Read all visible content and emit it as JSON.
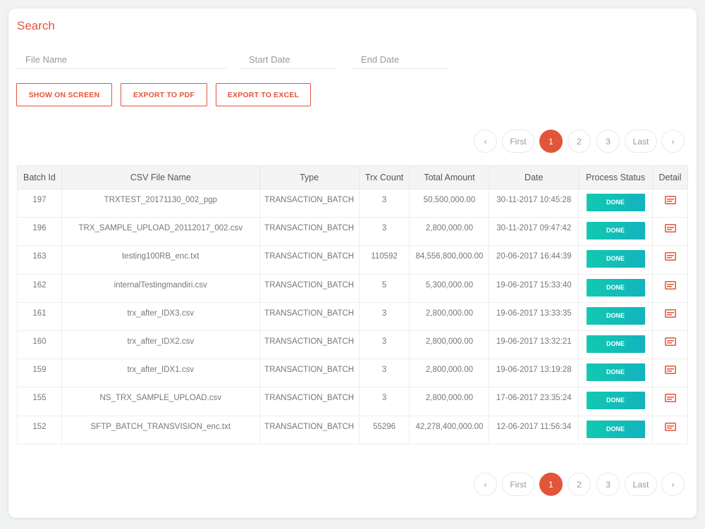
{
  "search": {
    "title": "Search",
    "file_name_placeholder": "File Name",
    "start_date_placeholder": "Start Date",
    "end_date_placeholder": "End Date"
  },
  "buttons": {
    "show_on_screen": "SHOW ON SCREEN",
    "export_pdf": "EXPORT TO PDF",
    "export_excel": "EXPORT TO EXCEL"
  },
  "pagination": {
    "prev": "‹",
    "first": "First",
    "pages": [
      "1",
      "2",
      "3"
    ],
    "current": "1",
    "last": "Last",
    "next": "›"
  },
  "table": {
    "headers": [
      "Batch Id",
      "CSV File Name",
      "Type",
      "Trx Count",
      "Total Amount",
      "Date",
      "Process Status",
      "Detail"
    ],
    "rows": [
      {
        "id": "197",
        "file": "TRXTEST_20171130_002_pgp",
        "type": "TRANSACTION_BATCH",
        "count": "3",
        "amount": "50,500,000.00",
        "date": "30-11-2017 10:45:28",
        "status": "DONE"
      },
      {
        "id": "196",
        "file": "TRX_SAMPLE_UPLOAD_20112017_002.csv",
        "type": "TRANSACTION_BATCH",
        "count": "3",
        "amount": "2,800,000.00",
        "date": "30-11-2017 09:47:42",
        "status": "DONE"
      },
      {
        "id": "163",
        "file": "testing100RB_enc.txt",
        "type": "TRANSACTION_BATCH",
        "count": "110592",
        "amount": "84,556,800,000.00",
        "date": "20-06-2017 16:44:39",
        "status": "DONE"
      },
      {
        "id": "162",
        "file": "internalTestingmandiri.csv",
        "type": "TRANSACTION_BATCH",
        "count": "5",
        "amount": "5,300,000.00",
        "date": "19-06-2017 15:33:40",
        "status": "DONE"
      },
      {
        "id": "161",
        "file": "trx_after_IDX3.csv",
        "type": "TRANSACTION_BATCH",
        "count": "3",
        "amount": "2,800,000.00",
        "date": "19-06-2017 13:33:35",
        "status": "DONE"
      },
      {
        "id": "160",
        "file": "trx_after_IDX2.csv",
        "type": "TRANSACTION_BATCH",
        "count": "3",
        "amount": "2,800,000.00",
        "date": "19-06-2017 13:32:21",
        "status": "DONE"
      },
      {
        "id": "159",
        "file": "trx_after_IDX1.csv",
        "type": "TRANSACTION_BATCH",
        "count": "3",
        "amount": "2,800,000.00",
        "date": "19-06-2017 13:19:28",
        "status": "DONE"
      },
      {
        "id": "155",
        "file": "NS_TRX_SAMPLE_UPLOAD.csv",
        "type": "TRANSACTION_BATCH",
        "count": "3",
        "amount": "2,800,000.00",
        "date": "17-06-2017 23:35:24",
        "status": "DONE"
      },
      {
        "id": "152",
        "file": "SFTP_BATCH_TRANSVISION_enc.txt",
        "type": "TRANSACTION_BATCH",
        "count": "55296",
        "amount": "42,278,400,000.00",
        "date": "12-06-2017 11:56:34",
        "status": "DONE"
      }
    ]
  },
  "icons": {
    "detail": "document-icon"
  },
  "colors": {
    "accent": "#e2553a",
    "status_done": "#12c9b1"
  }
}
